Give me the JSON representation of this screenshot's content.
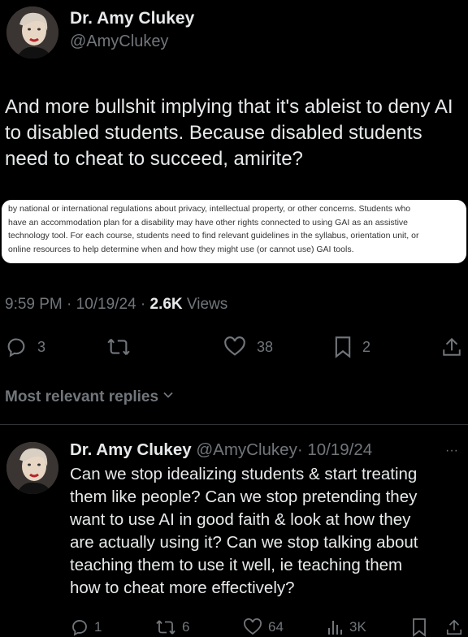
{
  "main_tweet": {
    "author_name": "Dr. Amy Clukey",
    "author_handle": "@AmyClukey",
    "text": "And more bullshit implying that it's ableist to deny AI to disabled students. Because disabled students need to cheat to succeed, amirite?",
    "image_lines": [
      "by national or international regulations about privacy, intellectual property, or other concerns. Students who",
      "have an accommodation plan for a disability may have other rights connected to using GAI as an assistive",
      "technology tool. For each course, students need to find relevant guidelines in the syllabus, orientation unit, or",
      "online resources to help determine when and how they might use (or cannot use) GAI tools."
    ],
    "timestamp": "9:59 PM · 10/19/24 · ",
    "views_count": "2.6K",
    "views_label": " Views",
    "replies": "3",
    "likes": "38",
    "bookmarks": "2"
  },
  "replies_sort": {
    "label": "Most relevant replies"
  },
  "reply": {
    "author_name": "Dr. Amy Clukey",
    "author_handle": "@AmyClukey",
    "date": "· 10/19/24",
    "more": "···",
    "text_lines": [
      "Can we stop idealizing students & start treating",
      "them like people? Can we stop pretending they",
      "want to use AI in good faith & look at how they",
      "are actually using it? Can we stop talking about",
      "teaching them to use it well, ie teaching them",
      "how to cheat more effectively?"
    ],
    "replies": "1",
    "retweets": "6",
    "likes": "64",
    "views": "3K"
  },
  "icons": {
    "reply": "reply-icon",
    "retweet": "retweet-icon",
    "like": "heart-icon",
    "bookmark": "bookmark-icon",
    "share": "share-icon",
    "views": "views-icon",
    "chevron": "chevron-down-icon"
  }
}
